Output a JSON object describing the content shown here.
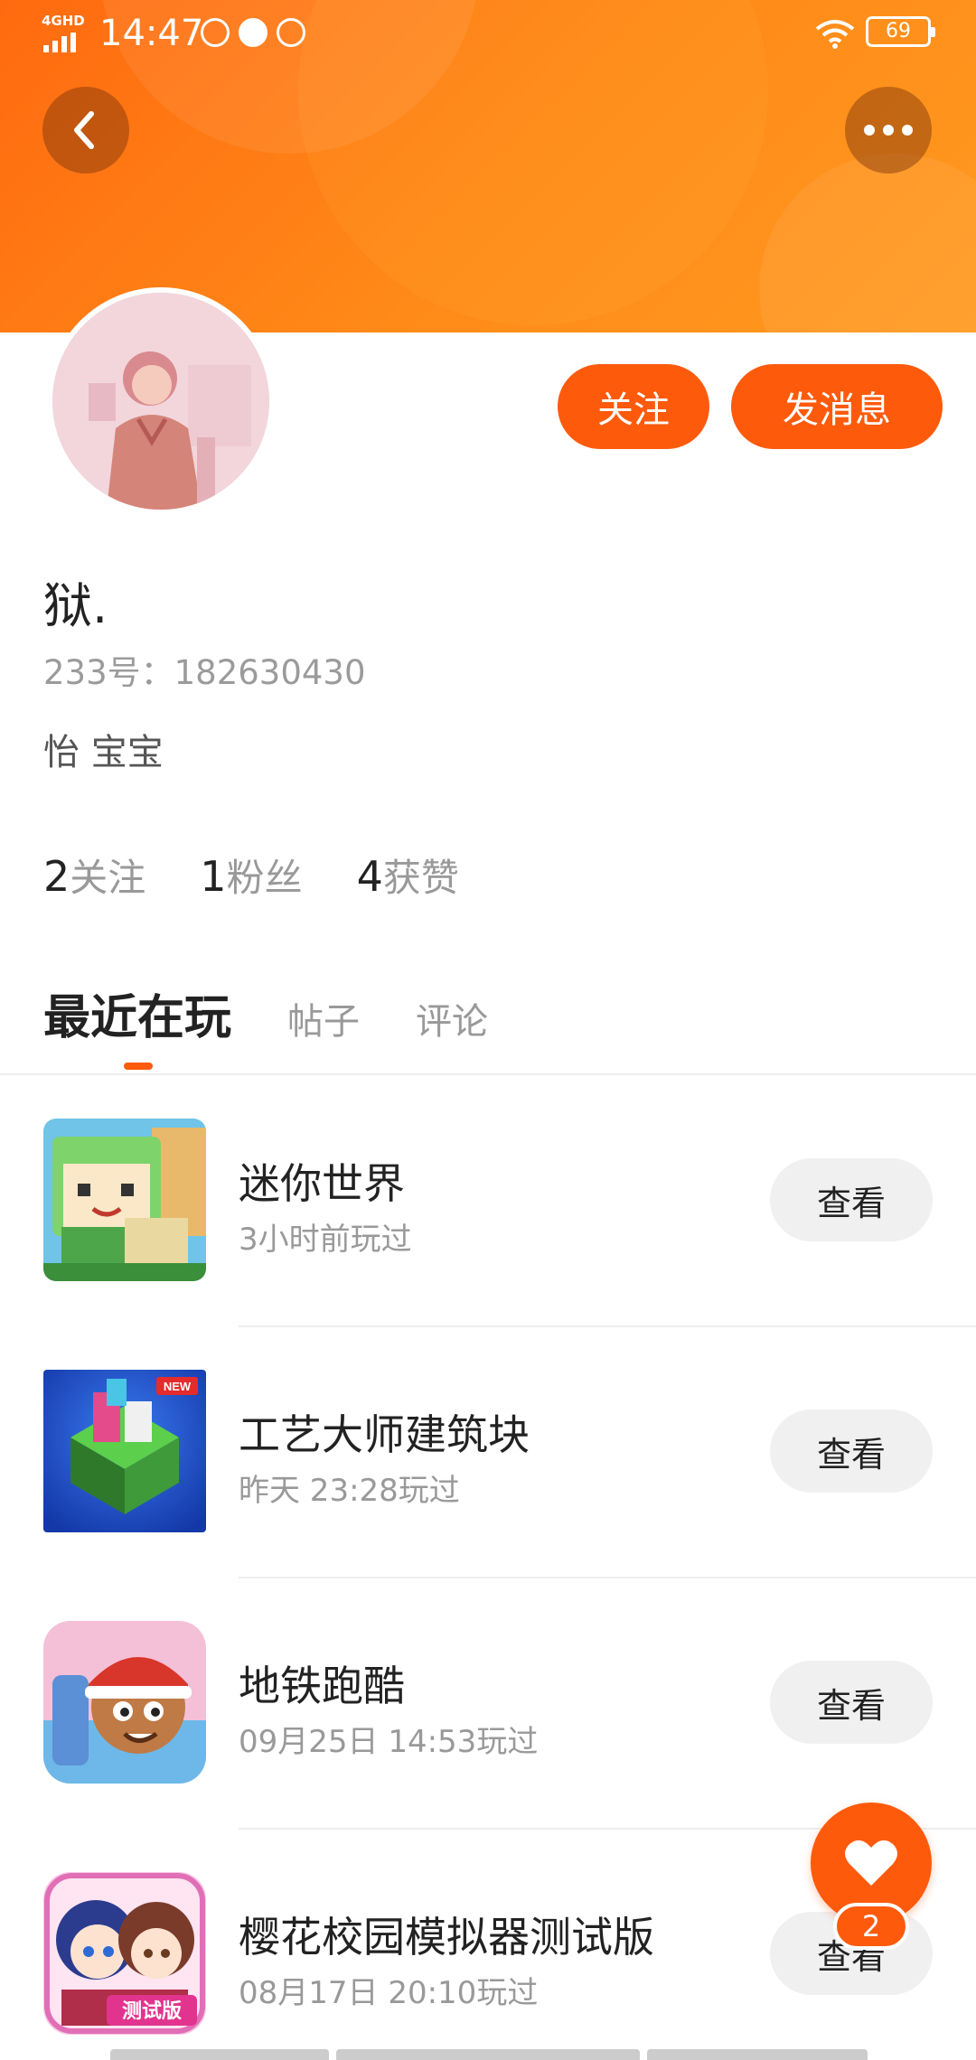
{
  "status_bar": {
    "network": "4GHD",
    "time": "14:47",
    "battery": "69"
  },
  "profile": {
    "username": "狱.",
    "uid": "233号：182630430",
    "signature": "怡 宝宝",
    "follow_label": "关注",
    "message_label": "发消息"
  },
  "stats": [
    {
      "num": "2",
      "label": "关注"
    },
    {
      "num": "1",
      "label": "粉丝"
    },
    {
      "num": "4",
      "label": "获赞"
    }
  ],
  "tabs": {
    "active": "最近在玩",
    "posts": "帖子",
    "comments": "评论"
  },
  "games": [
    {
      "name": "迷你世界",
      "time": "3小时前玩过",
      "button": "查看",
      "icon": "mini-world-icon"
    },
    {
      "name": "工艺大师建筑块",
      "time": "昨天 23:28玩过",
      "button": "查看",
      "icon": "craft-master-icon",
      "badge": "NEW"
    },
    {
      "name": "地铁跑酷",
      "time": "09月25日 14:53玩过",
      "button": "查看",
      "icon": "subway-surfers-icon"
    },
    {
      "name": "樱花校园模拟器测试版",
      "time": "08月17日 20:10玩过",
      "button": "查看",
      "icon": "sakura-school-icon",
      "badge": "测试版"
    }
  ],
  "fab": {
    "badge_count": "2"
  },
  "colors": {
    "accent": "#fe5a0c",
    "header_gradient_start": "#ff6a10",
    "header_gradient_end": "#ff9a20"
  }
}
